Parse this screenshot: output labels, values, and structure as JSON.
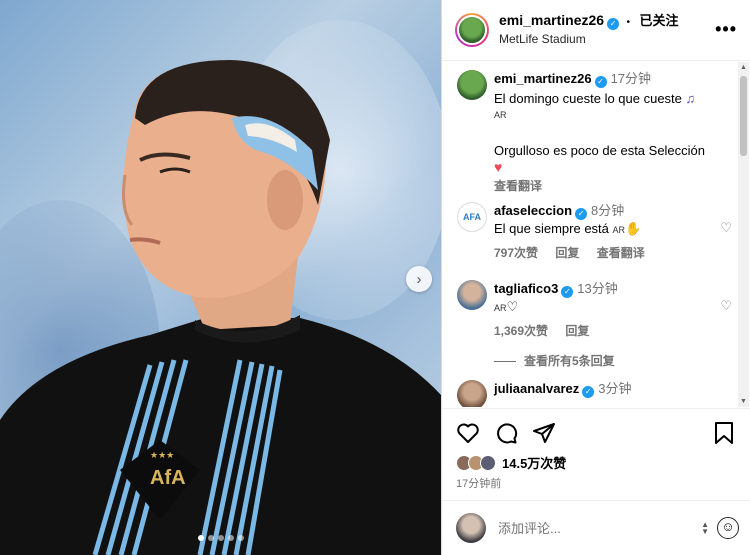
{
  "photo": {
    "next_label": "›",
    "dot_count": 5,
    "active_dot": 0
  },
  "header": {
    "username": "emi_martinez26",
    "verified_glyph": "✓",
    "follow_status": "已关注",
    "separator": "•",
    "location": "MetLife Stadium",
    "more": "•••"
  },
  "caption": {
    "username": "emi_martinez26",
    "time": "17分钟",
    "line1": "El domingo cueste lo que cueste",
    "flag1": "AR",
    "line2": "Orgulloso es poco de esta Selección",
    "heart": "♥",
    "translate": "查看翻译"
  },
  "comments": [
    {
      "username": "afaseleccion",
      "time": "8分钟",
      "text": "El que siempre está",
      "flag": "AR",
      "likes": "797次赞",
      "reply": "回复",
      "translate": "查看翻译"
    },
    {
      "username": "tagliafico3",
      "time": "13分钟",
      "flag": "AR",
      "likes": "1,369次赞",
      "reply": "回复"
    },
    {
      "username": "juliaanalvarez",
      "time": "3分钟"
    }
  ],
  "view_replies": "查看所有5条回复",
  "actions": {
    "likes": "14.5万次赞",
    "posted": "17分钟前"
  },
  "composer": {
    "placeholder": "添加评论..."
  },
  "icons": [
    "like-icon",
    "comment-icon",
    "share-icon",
    "save-icon",
    "emoji-icon",
    "more-icon",
    "verified-icon",
    "heart-icon"
  ],
  "colors": {
    "verified": "#1d9bf0",
    "heart": "#ed4956",
    "muted": "#737373",
    "jersey_stripe": "#7ab8e6"
  }
}
